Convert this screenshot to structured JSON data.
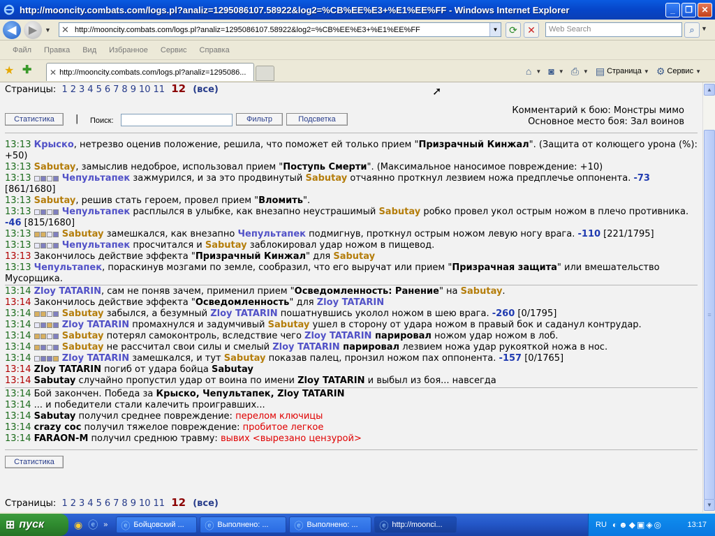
{
  "window": {
    "title": "http://mooncity.combats.com/logs.pl?analiz=1295086107.58922&log2=%CB%EE%E3+%E1%EE%FF - Windows Internet Explorer"
  },
  "address": {
    "url": "http://mooncity.combats.com/logs.pl?analiz=1295086107.58922&log2=%CB%EE%E3+%E1%EE%FF",
    "search_placeholder": "Web Search"
  },
  "menu": [
    "Файл",
    "Правка",
    "Вид",
    "Избранное",
    "Сервис",
    "Справка"
  ],
  "tab": {
    "label": "http://mooncity.combats.com/logs.pl?analiz=1295086..."
  },
  "toolbar": {
    "page_label": "Страница",
    "tools_label": "Сервис"
  },
  "pages": {
    "label": "Страницы:",
    "numbers": [
      "1",
      "2",
      "3",
      "4",
      "5",
      "6",
      "7",
      "8",
      "9",
      "10",
      "11"
    ],
    "current": "12",
    "all": "(все)"
  },
  "controls": {
    "stats_label": "Статистика",
    "sep": "|",
    "search_label": "Поиск:",
    "filter_label": "Фильтр",
    "highlight_label": "Подсветка"
  },
  "comment": {
    "line1": "Комментарий к бою: Монстры мимо",
    "line2": "Основное место боя: Зал воинов"
  },
  "log": {
    "l1": {
      "t": "13:13",
      "a": "Крыско",
      "b": ", нетрезво оценив положение, решила, что поможет ей только прием \"",
      "c": "Призрачный Кинжал",
      "d": "\". (Защита от колющего урона (%): +50)"
    },
    "l2": {
      "t": "13:13",
      "a": "Sabutay",
      "b": ", замыслив недоброе, использовал прием \"",
      "c": "Поступь Смерти",
      "d": "\". (Максимальное наносимое повреждение: +10)"
    },
    "l3": {
      "t": "13:13",
      "a": "Чепультапек",
      "b": " зажмурился, и за это продвинутый ",
      "c": "Sabutay",
      "d": " отчаянно проткнул лезвием ножа предплечье оппонента. ",
      "e": "-73",
      "f": " [861/1680]"
    },
    "l4": {
      "t": "13:13",
      "a": "Sabutay",
      "b": ", решив стать героем, провел прием \"",
      "c": "Вломить",
      "d": "\"."
    },
    "l5": {
      "t": "13:13",
      "a": "Чепультапек",
      "b": " расплылся в улыбке, как внезапно неустрашимый ",
      "c": "Sabutay",
      "d": " робко провел укол острым ножом в плечо противника. ",
      "e": "-46",
      "f": " [815/1680]"
    },
    "l6": {
      "t": "13:13",
      "a": "Sabutay",
      "b": " замешкался, как внезапно ",
      "c": "Чепультапек",
      "d": " подмигнув, проткнул острым ножом левую ногу врага. ",
      "e": "-110",
      "f": " [221/1795]"
    },
    "l7": {
      "t": "13:13",
      "a": "Чепультапек",
      "b": " просчитался и ",
      "c": "Sabutay",
      "d": " заблокировал удар ножом в пищевод."
    },
    "l8": {
      "t": "13:13",
      "b": "Закончилось действие эффекта \"",
      "c": "Призрачный Кинжал",
      "d": "\" для ",
      "e": "Sabutay"
    },
    "l9": {
      "t": "13:13",
      "a": "Чепультапек",
      "b": ", пораскинув мозгами по земле, сообразил, что его выручат или прием \"",
      "c": "Призрачная защита",
      "d": "\" или вмешательство Мусорщика."
    },
    "l10": {
      "t": "13:14",
      "a": "Zloy TATARIN",
      "b": ", сам не поняв зачем, применил прием \"",
      "c": "Осведомленность: Ранение",
      "d": "\" на ",
      "e": "Sabutay",
      "f": "."
    },
    "l11": {
      "t": "13:14",
      "b": "Закончилось действие эффекта \"",
      "c": "Осведомленность",
      "d": "\" для ",
      "e": "Zloy TATARIN"
    },
    "l12": {
      "t": "13:14",
      "a": "Sabutay",
      "b": " забылся, а безумный ",
      "c": "Zloy TATARIN",
      "d": " пошатнувшись уколол ножом в шею врага. ",
      "e": "-260",
      "f": " [0/1795]"
    },
    "l13": {
      "t": "13:14",
      "a": "Zloy TATARIN",
      "b": " промахнулся и задумчивый ",
      "c": "Sabutay",
      "d": " ушел в сторону от удара ножом в правый бок и саданул контрудар."
    },
    "l14": {
      "t": "13:14",
      "a": "Sabutay",
      "b": " потерял самоконтроль, вследствие чего ",
      "c": "Zloy TATARIN",
      "d": " парировал",
      "e": " ножом удар ножом в лоб."
    },
    "l15": {
      "t": "13:14",
      "a": "Sabutay",
      "b": " не рассчитал свои силы и смелый ",
      "c": "Zloy TATARIN",
      "d": " парировал",
      "e": " лезвием ножа удар рукояткой ножа в нос."
    },
    "l16": {
      "t": "13:14",
      "a": "Zloy TATARIN",
      "b": " замешкался, и тут ",
      "c": "Sabutay",
      "d": " показав палец, пронзил ножом пах оппонента. ",
      "e": "-157",
      "f": " [0/1765]"
    },
    "l17": {
      "t": "13:14",
      "a": "Zloy TATARIN",
      "b": " погиб от удара бойца ",
      "c": "Sabutay"
    },
    "l18": {
      "t": "13:14",
      "a": "Sabutay",
      "b": " случайно пропустил удар от воина по имени ",
      "c": "Zloy TATARIN",
      "d": " и выбыл из боя... навсегда"
    },
    "l19": {
      "t": "13:14",
      "b": "Бой закончен. Победа за ",
      "c": "Крыско, Чепультапек, Zloy TATARIN"
    },
    "l20": {
      "t": "13:14",
      "b": "... и победители стали калечить проигравших..."
    },
    "l21": {
      "t": "13:14",
      "a": "Sabutay",
      "b": " получил среднее повреждение: ",
      "c": "перелом ключицы"
    },
    "l22": {
      "t": "13:14",
      "a": "crazy coc",
      "b": " получил тяжелое повреждение: ",
      "c": "пробитое легкое"
    },
    "l23": {
      "t": "13:14",
      "a": "FARAON-M",
      "b": " получил среднюю травму: ",
      "c": "вывих <вырезано цензурой>"
    }
  },
  "taskbar": {
    "start": "пуск",
    "tasks": [
      "Бойцовский ...",
      "Выполнено: ...",
      "Выполнено: ...",
      "http://moonci..."
    ],
    "lang": "RU",
    "clock": "13:17"
  }
}
